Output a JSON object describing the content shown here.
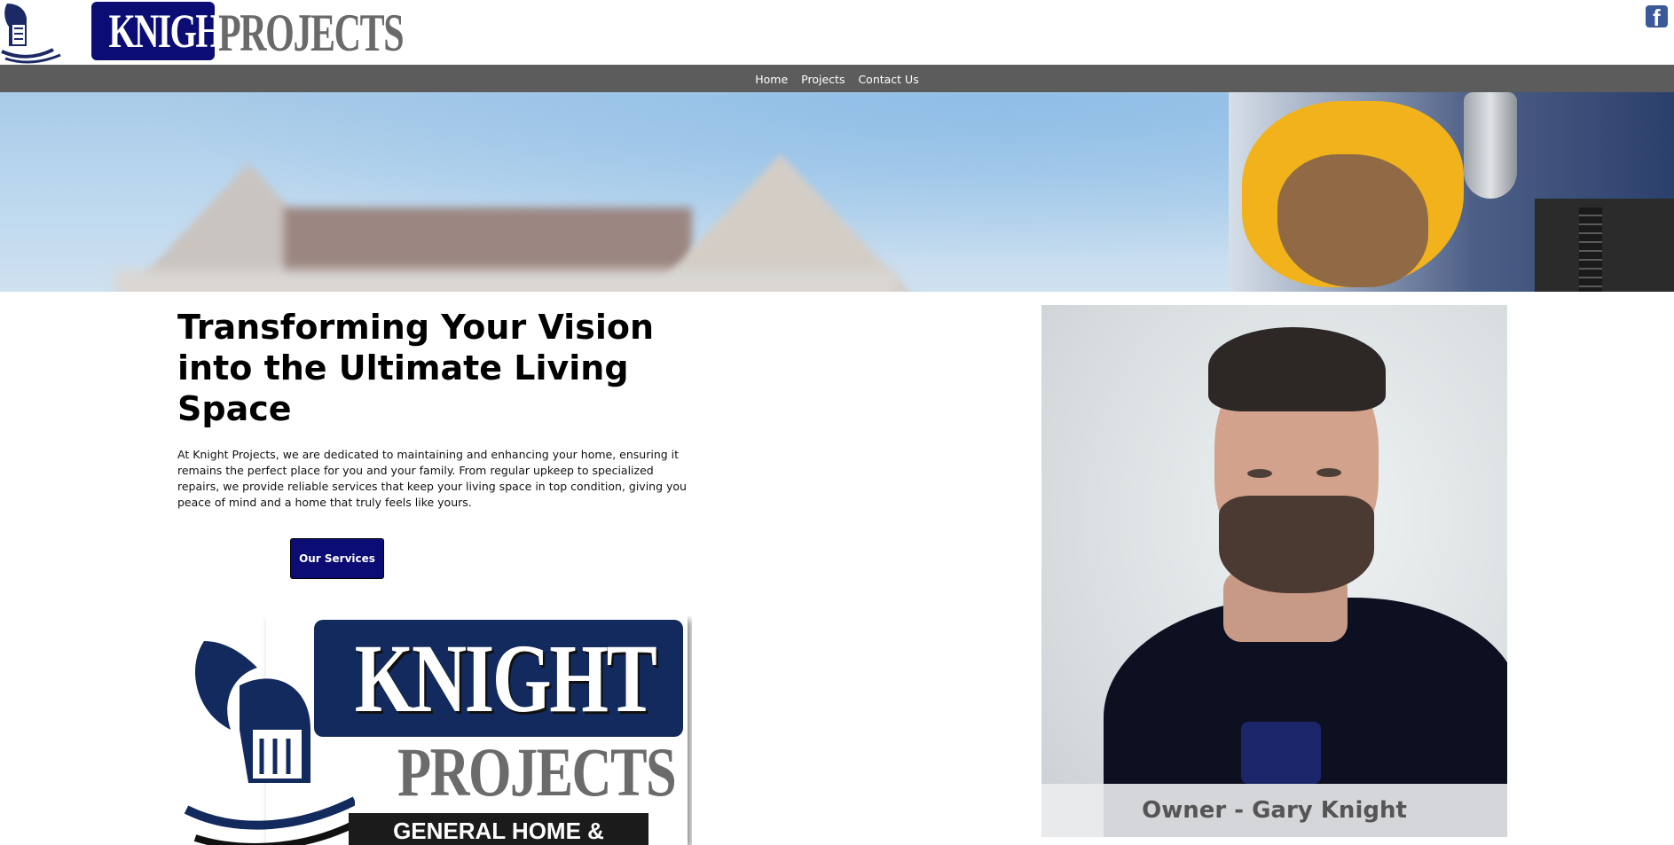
{
  "header": {
    "logo_word1": "KNIGHT",
    "logo_word2": "PROJECTS",
    "facebook_icon": "facebook-icon",
    "facebook_glyph": "f"
  },
  "nav": {
    "items": [
      {
        "label": "Home"
      },
      {
        "label": "Projects"
      },
      {
        "label": "Contact Us"
      }
    ]
  },
  "hero": {
    "description": "banner-image"
  },
  "main": {
    "headline": "Transforming Your Vision into the Ultimate Living Space",
    "intro": "At Knight Projects, we are dedicated to maintaining and enhancing your home, ensuring it remains the perfect place for you and your family. From regular upkeep to specialized repairs, we provide reliable services that keep your living space in top condition, giving you peace of mind and a home that truly feels like yours.",
    "services_button": "Our Services"
  },
  "big_logo": {
    "word1": "KNIGHT",
    "word2": "PROJECTS",
    "tagline": "GENERAL HOME &"
  },
  "owner": {
    "caption": "Owner - Gary Knight"
  },
  "colors": {
    "brand_navy": "#0b0c74",
    "nav_bg": "#5c5c5c",
    "logo_grey": "#6a6a6a",
    "facebook_blue": "#3b5998"
  }
}
